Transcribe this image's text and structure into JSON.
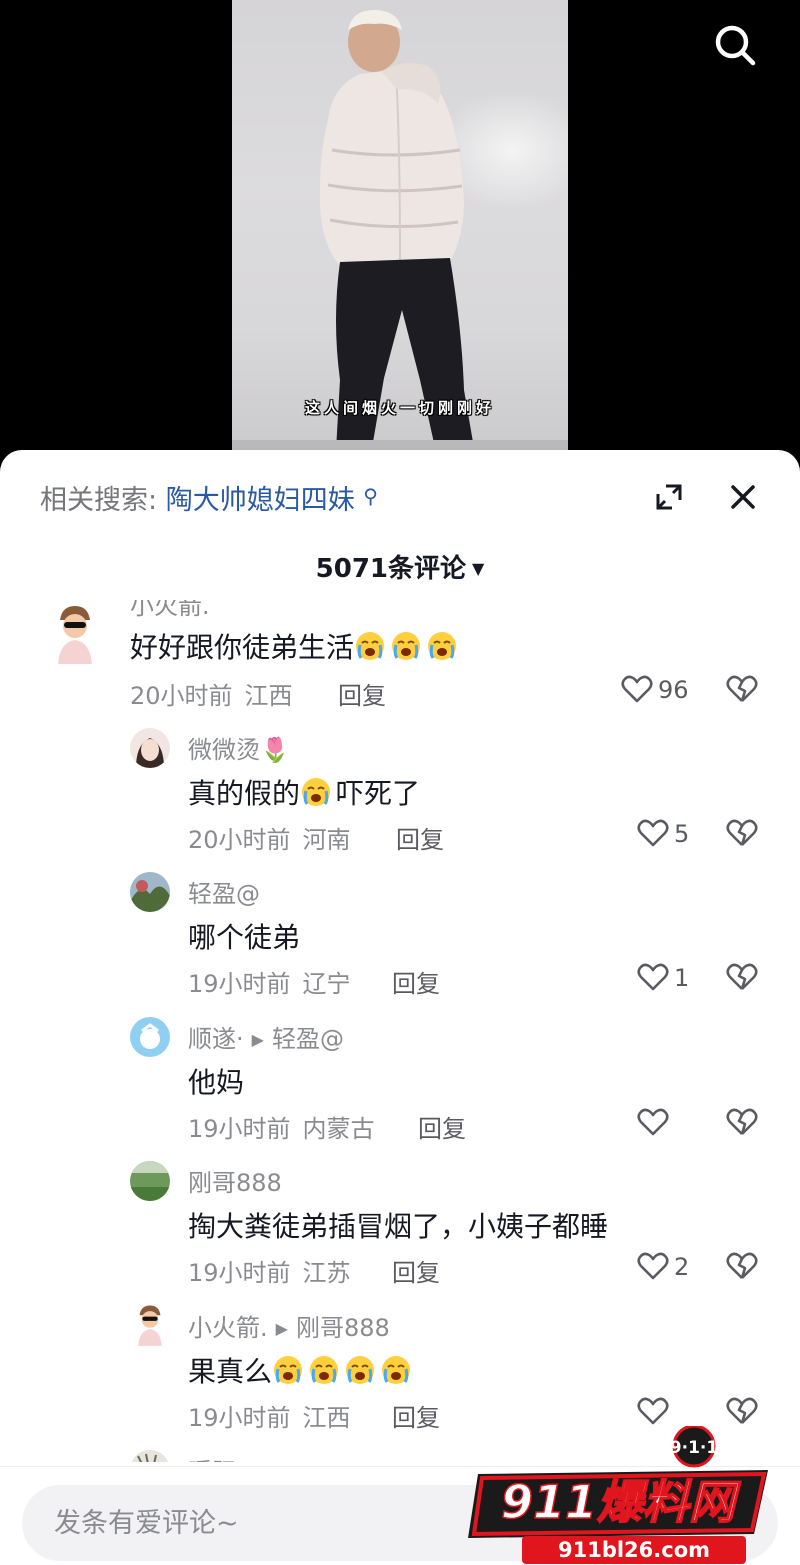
{
  "video": {
    "subtitle": "这人间烟火一切刚刚好",
    "search_icon": "search-icon"
  },
  "sheet": {
    "related_label": "相关搜索:",
    "related_term": "陶大帅媳妇四妹",
    "search_glyph": "⚲",
    "expand_icon": "expand-icon",
    "close_icon": "close-icon",
    "comment_count": "5071条评论",
    "count_caret": "▼"
  },
  "comments": [
    {
      "username": "小火箭.",
      "text": "好好跟你徒弟生活",
      "emoji_count": 3,
      "time": "20小时前",
      "location": "江西",
      "reply_label": "回复",
      "likes": "96"
    },
    {
      "username": "微微烫",
      "username_emoji": "🌷",
      "text_before": "真的假的",
      "text_after": "吓死了",
      "time": "20小时前",
      "location": "河南",
      "reply_label": "回复",
      "likes": "5"
    },
    {
      "username": "轻盈@",
      "text": "哪个徒弟",
      "time": "19小时前",
      "location": "辽宁",
      "reply_label": "回复",
      "likes": "1"
    },
    {
      "username": "顺遂·",
      "reply_to": "轻盈@",
      "text": "他妈",
      "time": "19小时前",
      "location": "内蒙古",
      "reply_label": "回复",
      "likes": ""
    },
    {
      "username": "刚哥888",
      "text": "掏大粪徒弟插冒烟了，小姨子都睡",
      "time": "19小时前",
      "location": "江苏",
      "reply_label": "回复",
      "likes": "2"
    },
    {
      "username": "小火箭.",
      "reply_to": "刚哥888",
      "text": "果真么",
      "emoji_count": 4,
      "time": "19小时前",
      "location": "江西",
      "reply_label": "回复",
      "likes": ""
    },
    {
      "username": "暖阳",
      "text": ""
    }
  ],
  "input": {
    "placeholder": "发条有爱评论~"
  },
  "watermark": {
    "badge": "9·1·1",
    "brand": "911爆料网",
    "url": "911bl26.com"
  },
  "colors": {
    "link_blue": "#2a5aa5",
    "muted_gray": "#8a8b91",
    "primary_text": "#161823",
    "watermark_red": "#e0151d"
  }
}
